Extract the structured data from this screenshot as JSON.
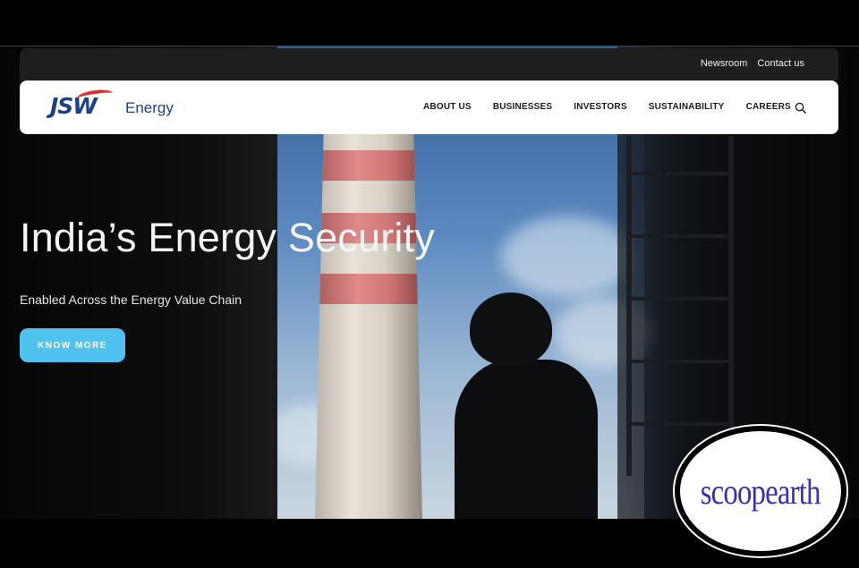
{
  "utility_links": [
    "Newsroom",
    "Contact us"
  ],
  "brand": {
    "logo_mark": "JSW",
    "logo_text": "Energy",
    "primary_color": "#1e3f8a",
    "accent_color": "#e2312d"
  },
  "nav": {
    "items": [
      "ABOUT US",
      "BUSINESSES",
      "INVESTORS",
      "SUSTAINABILITY",
      "CAREERS"
    ],
    "search_icon": "search-icon"
  },
  "hero": {
    "title": "India’s Energy Security",
    "subtitle": "Enabled Across the Energy Value Chain",
    "cta_label": "KNOW MORE",
    "cta_color": "#4fc2ef"
  },
  "watermark": {
    "text": "scoopearth",
    "color": "#3a2fb0"
  }
}
